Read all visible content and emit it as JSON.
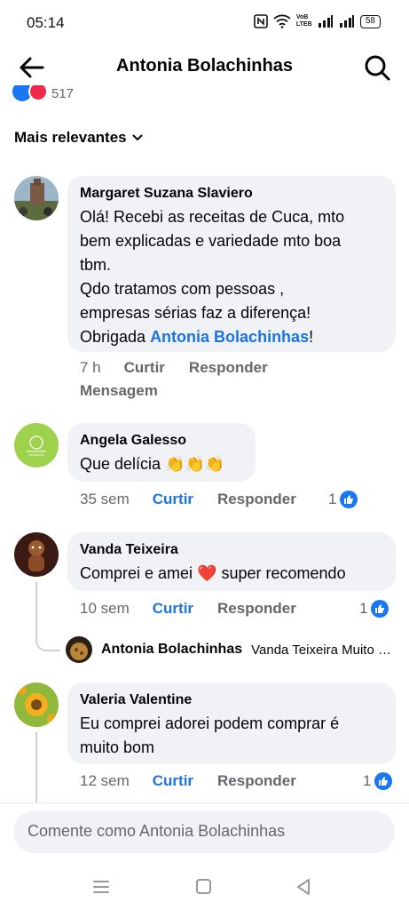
{
  "status_bar": {
    "time": "05:14",
    "network_label": "VoB LTEB",
    "battery": "58"
  },
  "header": {
    "title": "Antonia Bolachinhas",
    "back_icon": "arrow-left-icon",
    "search_icon": "search-icon"
  },
  "reactions": {
    "count": "517",
    "icons": [
      "like-icon",
      "love-icon"
    ]
  },
  "sort": {
    "label": "Mais relevantes"
  },
  "comments": [
    {
      "author": "Margaret Suzana Slaviero",
      "lines": [
        "Olá! Recebi as receitas de Cuca, mto",
        "bem explicadas e variedade mto boa",
        "tbm.",
        "Qdo tratamos com pessoas ,",
        "empresas sérias faz a diferença!"
      ],
      "last_prefix": "Obrigada ",
      "mention": "Antonia Bolachinhas",
      "last_suffix": "!",
      "time": "7 h",
      "like_label": "Curtir",
      "reply_label": "Responder",
      "message_label": "Mensagem"
    },
    {
      "author": "Angela Galesso",
      "text": "Que delícia",
      "emoji": "👏👏👏",
      "time": "35 sem",
      "like_label": "Curtir",
      "reply_label": "Responder",
      "likes": "1"
    },
    {
      "author": "Vanda Teixeira",
      "text_before": "Comprei e amei",
      "emoji": "❤️",
      "text_after": "super recomendo",
      "time": "10 sem",
      "like_label": "Curtir",
      "reply_label": "Responder",
      "likes": "1",
      "reply": {
        "author": "Antonia Bolachinhas",
        "text": "Vanda Teixeira Muito obrigada"
      }
    },
    {
      "author": "Valeria Valentine",
      "lines": [
        "Eu comprei adorei podem comprar é",
        "muito bom"
      ],
      "time": "12 sem",
      "like_label": "Curtir",
      "reply_label": "Responder",
      "likes": "1"
    }
  ],
  "composer": {
    "placeholder": "Comente como Antonia Bolachinhas"
  },
  "nav": {
    "icons": [
      "menu-icon",
      "home-square-icon",
      "back-triangle-icon"
    ]
  },
  "colors": {
    "brand_blue": "#1b74e4",
    "bubble_bg": "#f0f2f5",
    "secondary_text": "#65676b"
  }
}
